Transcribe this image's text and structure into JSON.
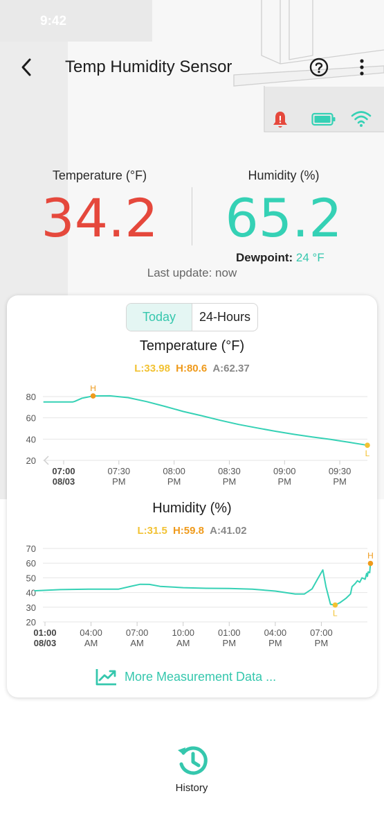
{
  "status_bar": {
    "time": "9:42"
  },
  "header": {
    "title": "Temp Humidity Sensor"
  },
  "icons": {
    "back": "chevron-left-icon",
    "help": "help-circle-icon",
    "more": "more-vertical-icon",
    "alarm": "bell-alert-icon",
    "battery": "battery-icon",
    "wifi": "wifi-icon",
    "more_data": "trend-chart-icon",
    "history": "history-icon"
  },
  "colors": {
    "temperature": "#e5483c",
    "humidity": "#35d1b5",
    "accent": "#35c7ad",
    "low": "#f2c233",
    "high": "#ef9a1b"
  },
  "readings": {
    "temperature_label": "Temperature (°F)",
    "temperature_value": "34.2",
    "humidity_label": "Humidity (%)",
    "humidity_value": "65.2",
    "dewpoint_label": "Dewpoint:",
    "dewpoint_value": "24 °F",
    "last_update": "Last update: now"
  },
  "range_tabs": {
    "options": [
      "Today",
      "24-Hours"
    ],
    "selected": "Today"
  },
  "more_data_label": "More Measurement Data ...",
  "history_label": "History",
  "chart_data": [
    {
      "type": "line",
      "title": "Temperature (°F)",
      "stats": {
        "low": "L:33.98",
        "high": "H:80.6",
        "avg": "A:62.37"
      },
      "ylim": [
        20,
        80
      ],
      "yticks": [
        "80",
        "60",
        "40",
        "20"
      ],
      "xlim": [
        0,
        165
      ],
      "xticks": [
        {
          "line1": "07:00",
          "line2": "08/03",
          "bold": true,
          "x": 0
        },
        {
          "line1": "07:30",
          "line2": "PM",
          "x": 30
        },
        {
          "line1": "08:00",
          "line2": "PM",
          "x": 60
        },
        {
          "line1": "08:30",
          "line2": "PM",
          "x": 90
        },
        {
          "line1": "09:00",
          "line2": "PM",
          "x": 120
        },
        {
          "line1": "09:30",
          "line2": "PM",
          "x": 150
        }
      ],
      "x_unit": "minutes after 07:00 PM",
      "series": [
        {
          "values": [
            [
              -11,
              75
            ],
            [
              5,
              75
            ],
            [
              6,
              75.5
            ],
            [
              10,
              78.5
            ],
            [
              16,
              80.6
            ],
            [
              25,
              80.7
            ],
            [
              35,
              79
            ],
            [
              45,
              75.3
            ],
            [
              55,
              70.8
            ],
            [
              65,
              66
            ],
            [
              75,
              62
            ],
            [
              85,
              57.7
            ],
            [
              95,
              53.8
            ],
            [
              105,
              50.5
            ],
            [
              115,
              47.4
            ],
            [
              125,
              44.5
            ],
            [
              135,
              42
            ],
            [
              145,
              39.7
            ],
            [
              155,
              37
            ],
            [
              165,
              34.2
            ]
          ]
        }
      ],
      "markers": [
        {
          "label": "H",
          "x": 16,
          "y": 80.6,
          "kind": "high"
        },
        {
          "label": "L",
          "x": 165,
          "y": 34.2,
          "kind": "low"
        }
      ],
      "grid": true
    },
    {
      "type": "line",
      "title": "Humidity (%)",
      "stats": {
        "low": "L:31.5",
        "high": "H:59.8",
        "avg": "A:41.02"
      },
      "ylim": [
        20,
        70
      ],
      "yticks": [
        "70",
        "60",
        "50",
        "40",
        "30",
        "20"
      ],
      "xlim": [
        0,
        21
      ],
      "xticks": [
        {
          "line1": "01:00",
          "line2": "08/03",
          "bold": true,
          "x": 0
        },
        {
          "line1": "04:00",
          "line2": "AM",
          "x": 3
        },
        {
          "line1": "07:00",
          "line2": "AM",
          "x": 6
        },
        {
          "line1": "10:00",
          "line2": "AM",
          "x": 9
        },
        {
          "line1": "01:00",
          "line2": "PM",
          "x": 12
        },
        {
          "line1": "04:00",
          "line2": "PM",
          "x": 15
        },
        {
          "line1": "07:00",
          "line2": "PM",
          "x": 18
        }
      ],
      "x_unit": "hours after 01:00 AM",
      "series": [
        {
          "values": [
            [
              -0.7,
              41.2
            ],
            [
              1,
              42
            ],
            [
              3,
              42.3
            ],
            [
              4.8,
              42.3
            ],
            [
              5.5,
              44
            ],
            [
              6.2,
              45.6
            ],
            [
              6.8,
              45.5
            ],
            [
              7.5,
              44.2
            ],
            [
              9,
              43.3
            ],
            [
              10.5,
              42.9
            ],
            [
              12,
              42.8
            ],
            [
              13.5,
              42.3
            ],
            [
              15,
              41
            ],
            [
              16.3,
              39
            ],
            [
              16.9,
              39
            ],
            [
              17.4,
              42.5
            ],
            [
              17.8,
              50
            ],
            [
              18.1,
              55.4
            ],
            [
              18.3,
              44
            ],
            [
              18.6,
              32
            ],
            [
              18.9,
              31.5
            ],
            [
              19.2,
              33
            ],
            [
              19.6,
              36
            ],
            [
              19.9,
              39
            ],
            [
              20,
              44
            ],
            [
              20.2,
              46
            ],
            [
              20.35,
              48
            ],
            [
              20.5,
              47
            ],
            [
              20.65,
              50
            ],
            [
              20.85,
              49
            ],
            [
              20.95,
              53
            ],
            [
              21,
              51
            ],
            [
              21.05,
              54
            ],
            [
              21.15,
              53.5
            ],
            [
              21.2,
              59.8
            ]
          ]
        }
      ],
      "markers": [
        {
          "label": "H",
          "x": 21.2,
          "y": 59.8,
          "kind": "high"
        },
        {
          "label": "L",
          "x": 18.9,
          "y": 31.5,
          "kind": "low"
        }
      ],
      "grid": true
    }
  ]
}
